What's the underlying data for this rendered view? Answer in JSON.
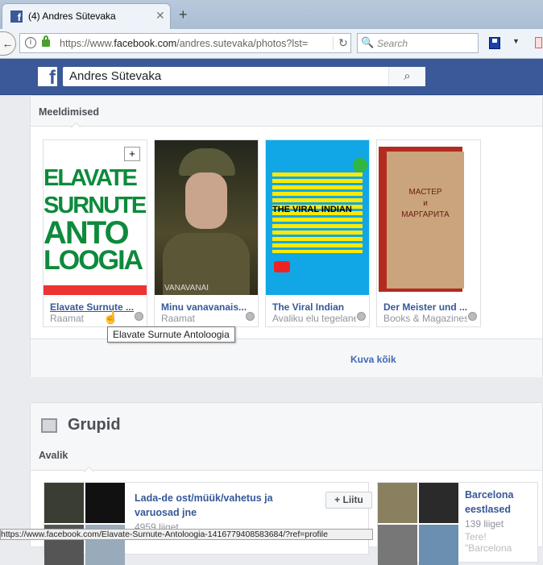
{
  "browser": {
    "tab_title": "(4) Andres Sütevaka",
    "url_domain_prefix": "https://www.",
    "url_domain": "facebook.com",
    "url_path": "/andres.sutevaka/photos?lst=",
    "search_placeholder": "Search",
    "status_url": "https://www.facebook.com/Elavate-Surnute-Antoloogia-1416779408583684/?ref=profile"
  },
  "header": {
    "logo": "f",
    "search_value": "Andres Sütevaka"
  },
  "likes": {
    "title": "Meeldimised",
    "items": [
      {
        "name": "Elavate Surnute ...",
        "category": "Raamat",
        "image_text": [
          "ELAVATE",
          "SURNUTE",
          "ANTO",
          "LOOGIA"
        ]
      },
      {
        "name": "Minu vanavanais...",
        "category": "Raamat",
        "image_text": [
          "VANAVANAI"
        ]
      },
      {
        "name": "The Viral Indian",
        "category": "Avaliku elu tegelane",
        "image_text": [
          "THE VIRAL INDIAN"
        ]
      },
      {
        "name": "Der Meister und ...",
        "category": "Books & Magazines",
        "image_text": [
          "МАСТЕР",
          "и",
          "МАРГАРИТА"
        ]
      }
    ],
    "tooltip": "Elavate Surnute Antoloogia",
    "see_all": "Kuva kõik"
  },
  "groups": {
    "title": "Grupid",
    "tab": "Avalik",
    "items": [
      {
        "name": "Lada-de ost/müük/vahetus ja varuosad jne",
        "members": "4959 liiget",
        "join": "Liitu"
      },
      {
        "name": "Barcelona eestlased",
        "members": "139 liiget",
        "desc": "Tere! \"Barcelona"
      }
    ]
  }
}
